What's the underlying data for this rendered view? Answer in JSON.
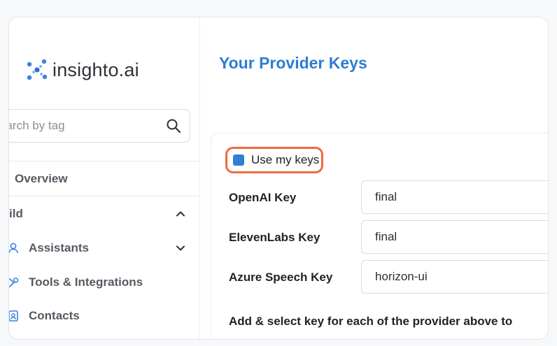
{
  "sidebar": {
    "logo_text": "insighto.ai",
    "search": {
      "placeholder": "earch by tag",
      "value": ""
    },
    "overview_label": "Overview",
    "build_section_label": "ild",
    "items": [
      {
        "label": "Assistants",
        "icon": "user-icon"
      },
      {
        "label": "Tools & Integrations",
        "icon": "tools-icon"
      },
      {
        "label": "Contacts",
        "icon": "contacts-icon"
      }
    ]
  },
  "main": {
    "title": "Your Provider Keys",
    "use_my_keys_label": "Use my keys",
    "use_my_keys_checked": true,
    "fields": [
      {
        "label": "OpenAI Key",
        "value": "final"
      },
      {
        "label": "ElevenLabs Key",
        "value": "final"
      },
      {
        "label": "Azure Speech Key",
        "value": "horizon-ui"
      }
    ],
    "footer_text": "Add & select key for each of the provider above to"
  },
  "colors": {
    "accent": "#2d7dd2",
    "checkbox": "#2f7fd6",
    "highlight": "#f26a3d"
  }
}
